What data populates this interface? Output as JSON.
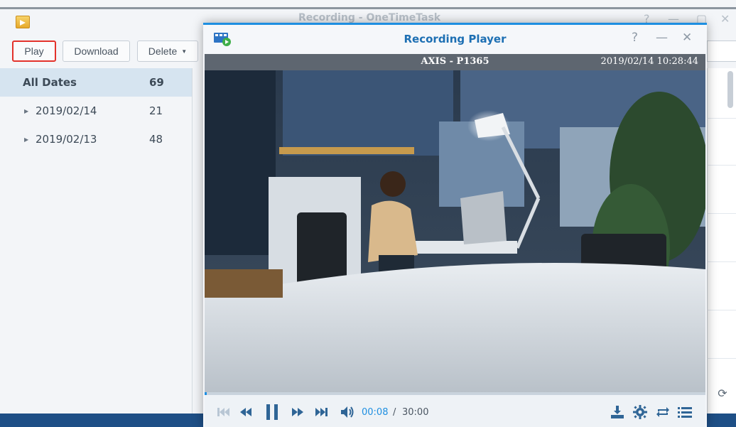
{
  "background_app": {
    "title": "Recording - OneTimeTask",
    "window_controls": [
      "?",
      "—",
      "▢",
      "✕"
    ],
    "toolbar": {
      "play_label": "Play",
      "download_label": "Download",
      "delete_label": "Delete"
    },
    "tree": [
      {
        "label": "All Dates",
        "count": "69",
        "selected": true
      },
      {
        "label": "2019/02/14",
        "count": "21",
        "selected": false
      },
      {
        "label": "2019/02/13",
        "count": "48",
        "selected": false
      }
    ]
  },
  "player": {
    "title": "Recording Player",
    "help_icon": "?",
    "minimize_icon": "—",
    "close_icon": "✕",
    "camera_name": "AXIS - P1365",
    "timestamp": "2019/02/14 10:28:44",
    "time_current": "00:08",
    "time_separator": "/",
    "time_total": "30:00",
    "progress_fraction": 0.0044,
    "controls": [
      "skip-previous-icon",
      "rewind-icon",
      "pause-icon",
      "fast-forward-icon",
      "skip-next-icon",
      "volume-icon"
    ],
    "right_controls": [
      "download-icon",
      "settings-icon",
      "repeat-icon",
      "playlist-icon"
    ]
  },
  "colors": {
    "accent": "#1e8fe1",
    "title_blue": "#1d6fb3",
    "play_highlight": "#e3322b"
  }
}
